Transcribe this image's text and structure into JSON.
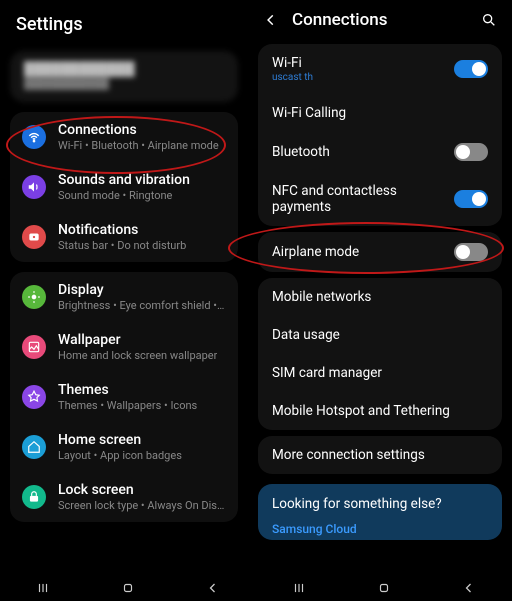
{
  "left": {
    "header_title": "Settings",
    "profile": {
      "name": "████████████",
      "sub": "████████████"
    },
    "items": [
      {
        "title": "Connections",
        "sub": "Wi-Fi • Bluetooth • Airplane mode",
        "icon": "wifi-icon",
        "color": "#1b6fe0"
      },
      {
        "title": "Sounds and vibration",
        "sub": "Sound mode • Ringtone",
        "icon": "sound-icon",
        "color": "#7b3fe4"
      },
      {
        "title": "Notifications",
        "sub": "Status bar • Do not disturb",
        "icon": "notifications-icon",
        "color": "#e04a4a"
      },
      {
        "title": "Display",
        "sub": "Brightness • Eye comfort shield • Navi",
        "icon": "display-icon",
        "color": "#57b83b"
      },
      {
        "title": "Wallpaper",
        "sub": "Home and lock screen wallpaper",
        "icon": "wallpaper-icon",
        "color": "#e84a7a"
      },
      {
        "title": "Themes",
        "sub": "Themes • Wallpapers • Icons",
        "icon": "themes-icon",
        "color": "#8a46e6"
      },
      {
        "title": "Home screen",
        "sub": "Layout • App icon badges",
        "icon": "home-icon",
        "color": "#1b9ed6"
      },
      {
        "title": "Lock screen",
        "sub": "Screen lock type • Always On Display",
        "icon": "lock-icon",
        "color": "#12b98c"
      }
    ]
  },
  "right": {
    "header_title": "Connections",
    "groups": [
      [
        {
          "title": "Wi-Fi",
          "sub": "uscast th",
          "toggle": true,
          "on": true
        },
        {
          "title": "Wi-Fi Calling"
        },
        {
          "title": "Bluetooth",
          "toggle": true,
          "on": false
        },
        {
          "title": "NFC and contactless payments",
          "toggle": true,
          "on": true
        }
      ],
      [
        {
          "title": "Airplane mode",
          "toggle": true,
          "on": false
        }
      ],
      [
        {
          "title": "Mobile networks"
        },
        {
          "title": "Data usage"
        },
        {
          "title": "SIM card manager"
        },
        {
          "title": "Mobile Hotspot and Tethering"
        }
      ],
      [
        {
          "title": "More connection settings"
        }
      ]
    ],
    "suggest": {
      "title": "Looking for something else?",
      "link1": "Samsung Cloud"
    }
  }
}
